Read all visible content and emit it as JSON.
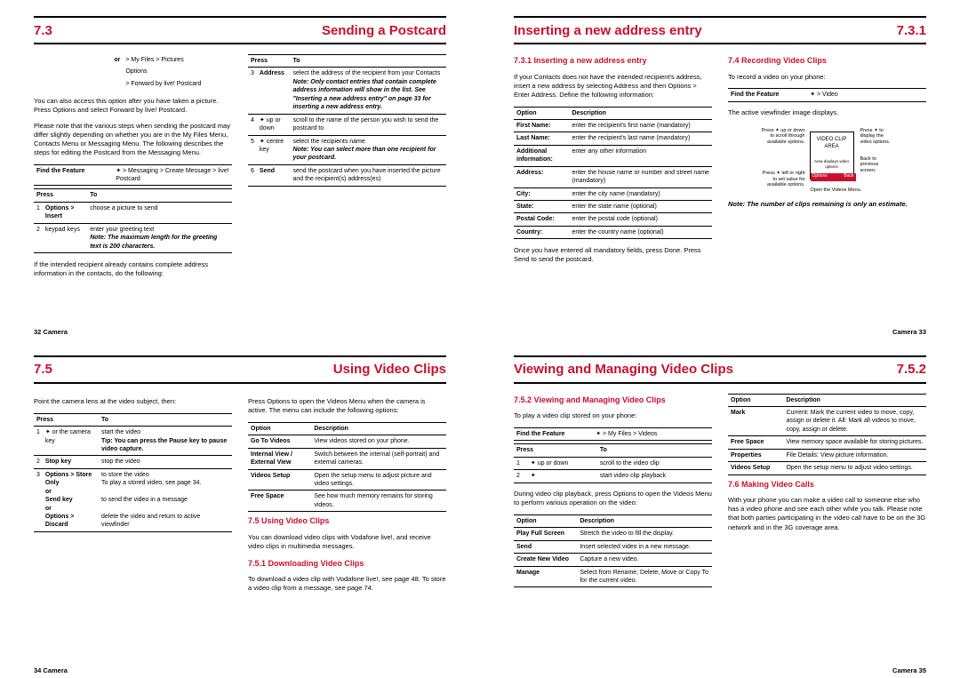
{
  "p32": {
    "num": "7.3",
    "title": "Sending a Postcard",
    "c1_or": "or",
    "c1_opt1": "> My Files > Pictures",
    "c1_opt2": "Options",
    "c1_opt3": "> Forward by live! Postcard",
    "p1": "You can also access this option after you have taken a picture. Press Options and select Forward by live! Postcard.",
    "p2": "Please note that the various steps when sending the postcard may differ slightly depending on whether you are in the My Files Menu, Contacts Menu or Messaging Menu. The following describes the steps for editing the Postcard from the Messaging Menu.",
    "find_label": "Find the Feature",
    "find_icon": "✦",
    "find_path": "> Messaging > Create Message > live! Postcard",
    "press": "Press",
    "to": "To",
    "r1a": "1",
    "r1b": "Options > Insert",
    "r1c": "choose a picture to send",
    "r2a": "2",
    "r2b": "keypad keys",
    "r2c": "enter your greeting text",
    "note1": "Note: The maximum length for the greeting text is 200 characters.",
    "p3": "If the intended recipient already contains complete address information in the contacts, do the following:",
    "press2": "Press",
    "to2": "To",
    "r3a": "3",
    "r3b": "Address",
    "r3c": "select the address of the recipient from your Contacts",
    "note2": "Note: Only contact entries that contain complete address information will show in the list. See \"Inserting a new address entry\" on page 33 for inserting a new address entry.",
    "r4a": "4",
    "r4b": "✦ up or down",
    "r4c": "scroll to the name of the person you wish to send the postcard to",
    "r5a": "5",
    "r5b": "✦ centre key",
    "r5c": "select the recipients name",
    "note3": "Note: You can select more than one recipient for your postcard.",
    "r6a": "6",
    "r6b": "Send",
    "r6c": "send the postcard when you have inserted the picture and the recipient(s) address(es)",
    "foot": "32   Camera"
  },
  "p33": {
    "title": "Inserting a new address entry",
    "num": "7.3.1",
    "h1": "7.3.1 Inserting a new address entry",
    "p1": "If your Contacts does not have the intended recipient's address, insert a new address by selecting Address and then Options > Enter Address. Define the following information:",
    "opt": "Option",
    "desc": "Description",
    "r1a": "First Name:",
    "r1b": "enter the recipient's first name (mandatory)",
    "r2a": "Last Name:",
    "r2b": "enter the recipient's last name (mandatory)",
    "r3a": "Additional information:",
    "r3b": "enter any other information",
    "r4a": "Address:",
    "r4b": "enter the house name or number and street name (mandatory)",
    "r5a": "City:",
    "r5b": "enter the city name (mandatory)",
    "r6a": "State:",
    "r6b": "enter the state name (optional)",
    "r7a": "Postal Code:",
    "r7b": "enter the postal code (optional)",
    "r8a": "Country:",
    "r8b": "enter the country name (optional)",
    "p2": "Once you have entered all mandatory fields, press Done. Press Send to send the postcard.",
    "h2": "7.4 Recording Video Clips",
    "p3": "To record a video on your phone:",
    "find_label": "Find the Feature",
    "find_icon": "✦",
    "find_path": "> Video",
    "p4": "The active viewfinder image displays.",
    "d_t1": "Press ✦ up or down to scroll through available options.",
    "d_t2": "Press ✦ to display the video options.",
    "d_t3": "Press ✦ left or right to set value for available options.",
    "d_t4": "Back to previous screen.",
    "d_t5": "Open the Videos Menu.",
    "d_box": "VIDEO CLIP AREA",
    "d_sub": "Area displays video options",
    "d_bar_l": "Options",
    "d_bar_r": "Back",
    "note": "Note: The number of clips remaining is only an estimate.",
    "foot": "Camera   33"
  },
  "p34": {
    "num": "7.5",
    "title": "Using Video Clips",
    "p1": "Point the camera lens at the video subject, then:",
    "press": "Press",
    "to": "To",
    "r1a": "1",
    "r1b": "✦ or the camera key",
    "r1c": "start the video",
    "r1tip": "Tip: You can press the Pause key to pause video capture.",
    "r2a": "2",
    "r2b": "Stop key",
    "r2c": "stop the video",
    "r3a": "3",
    "r3b": "Options > Store Only",
    "r3b_or": "or",
    "r3b2": "Send key",
    "r3b_or2": "or",
    "r3b3": "Options > Discard",
    "r3c": "to store the video",
    "r3c2": "To play a stored video, see page 34.",
    "r3c3": "to send the video in a message",
    "r3c4": "delete the video and return to active viewfinder",
    "p2": "Press Options to open the Videos Menu when the camera is active. The menu can include the following options:",
    "opt": "Option",
    "desc": "Description",
    "t2r1a": "Go To Videos",
    "t2r1b": "View videos stored on your phone.",
    "t2r2a": "Internal View / External View",
    "t2r2b": "Switch between the internal (self-portrait) and external cameras.",
    "t2r3a": "Videos Setup",
    "t2r3b": "Open the setup menu to adjust picture and video settings.",
    "t2r4a": "Free Space",
    "t2r4b": "See how much memory remains for storing videos.",
    "h1": "7.5 Using Video Clips",
    "p3": "You can download video clips with Vodafone live!, and receive video clips in multimedia messages.",
    "h2": "7.5.1 Downloading Video Clips",
    "p4": "To download a video clip with Vodafone live!, see page 48. To store a video clip from a message, see page 74.",
    "foot": "34   Camera"
  },
  "p35": {
    "title": "Viewing and Managing Video Clips",
    "num": "7.5.2",
    "h1": "7.5.2 Viewing and Managing Video Clips",
    "p1": "To play a video clip stored on your phone:",
    "find_label": "Find the Feature",
    "find_icon": "✦",
    "find_path": "> My Files > Videos",
    "press": "Press",
    "to": "To",
    "r1a": "1",
    "r1b": "✦ up or down",
    "r1c": "scroll to the video clip",
    "r2a": "2",
    "r2b": "✦",
    "r2c": "start video clip playback",
    "p2": "During video clip playback, press Options to open the Videos Menu to perform various operation on the video:",
    "opt": "Option",
    "desc": "Description",
    "t2r1a": "Play Full Screen",
    "t2r1b": "Stretch the video to fill the display.",
    "t2r2a": "Send",
    "t2r2b": "Insert selected video in a new message.",
    "t2r3a": "Create New Video",
    "t2r3b": "Capture a new video.",
    "t2r4a": "Manage",
    "t2r4b": "Select from Rename, Delete, Move or Copy To for the current video.",
    "opt2": "Option",
    "desc2": "Description",
    "t3r1a": "Mark",
    "t3r1b": "Current: Mark the current video to move, copy, assign or delete it. All: Mark all videos to move, copy, assign or delete.",
    "t3r2a": "Free Space",
    "t3r2b": "View memory space available for storing pictures.",
    "t3r3a": "Properties",
    "t3r3b": "File Details: View picture information.",
    "t3r4a": "Videos Setup",
    "t3r4b": "Open the setup menu to adjust video settings.",
    "h2": "7.6 Making Video Calls",
    "p3": "With your phone you can make a video call to someone else who has a video phone and see each other while you talk. Please note that both parties participating in the video call have to be on the 3G network and in the 3G coverage area.",
    "foot": "Camera   35"
  }
}
